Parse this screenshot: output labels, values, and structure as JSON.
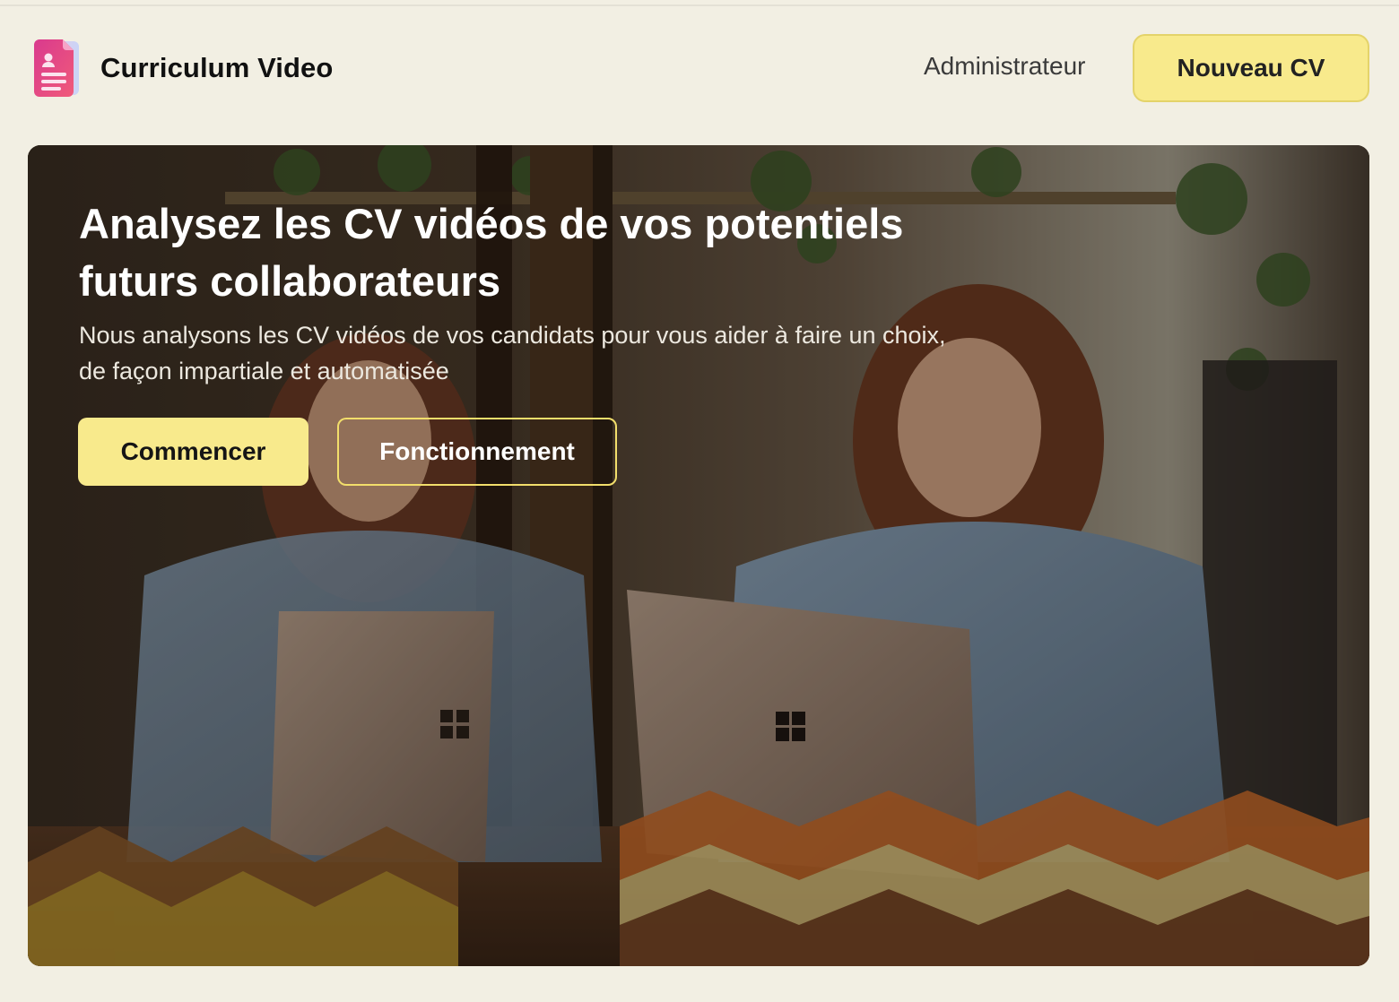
{
  "header": {
    "brand_name": "Curriculum Video",
    "logo_icon": "document-person-icon",
    "nav_admin": "Administrateur",
    "new_cv_button": "Nouveau CV"
  },
  "hero": {
    "title": "Analysez les CV vidéos de vos potentiels futurs collaborateurs",
    "subtitle": "Nous analysons les CV vidéos de vos candidats pour vous aider à faire un choix, de façon impartiale et automatisée",
    "primary_button": "Commencer",
    "secondary_button": "Fonctionnement"
  },
  "colors": {
    "background": "#f2efe3",
    "accent_yellow": "#f8ea8c",
    "accent_border": "#f2de6b",
    "logo_pink": "#e0417f"
  }
}
